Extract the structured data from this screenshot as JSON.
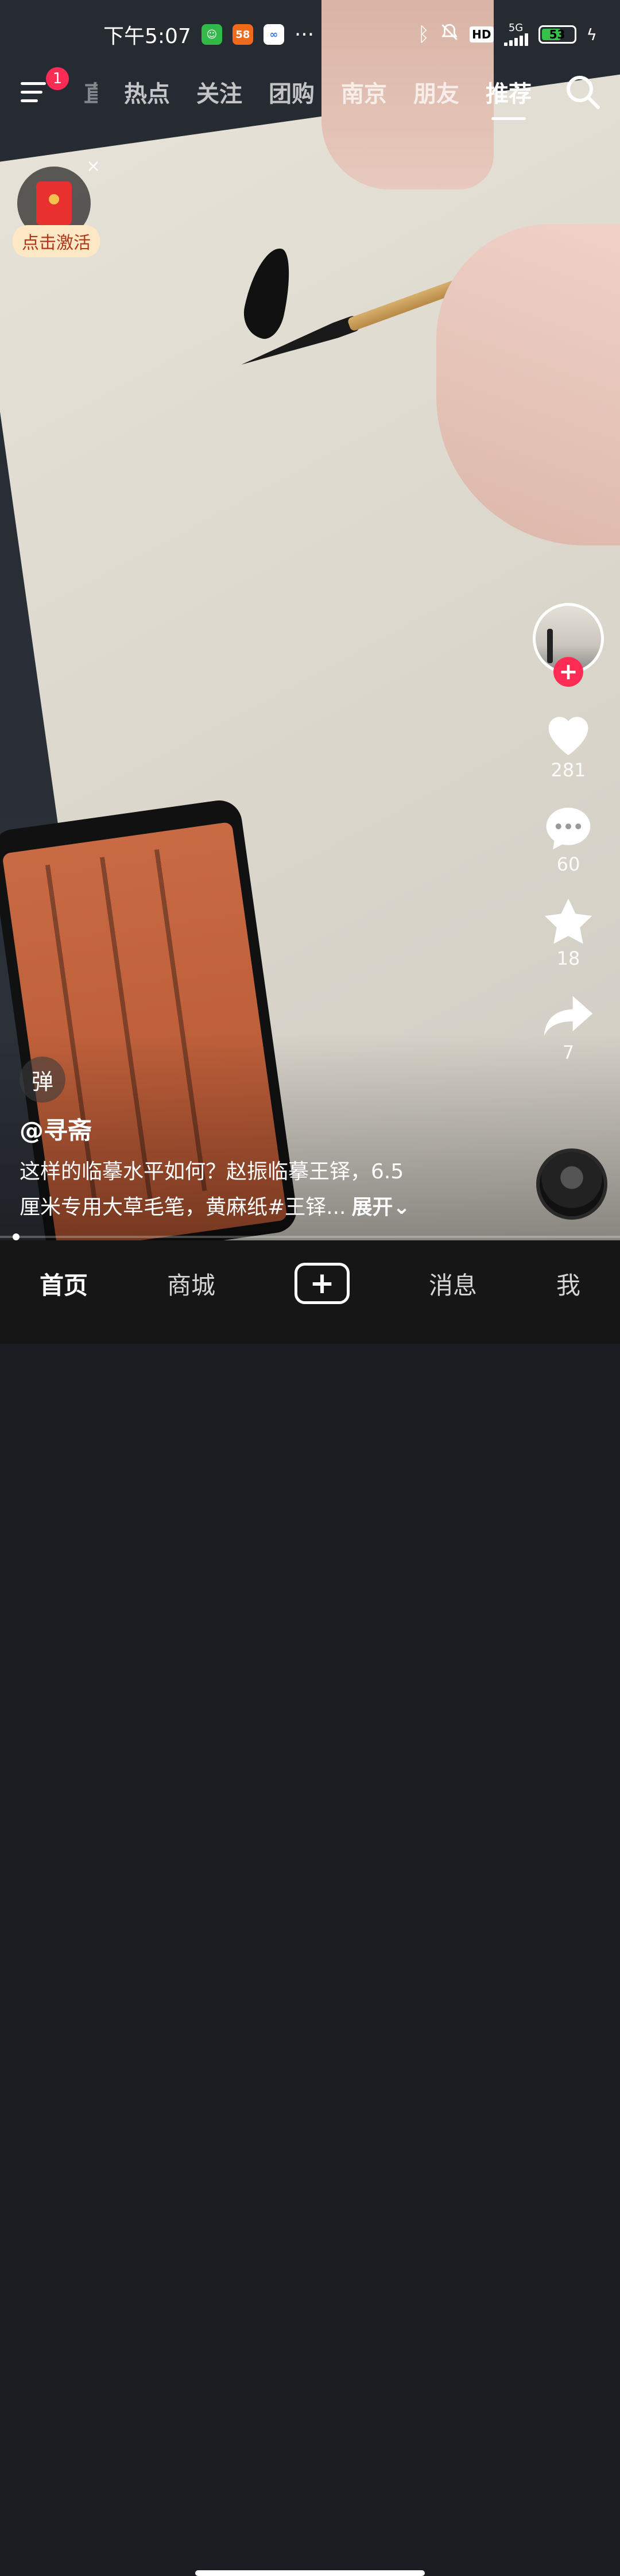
{
  "status_bar": {
    "time": "下午5:07",
    "app_58_label": "58",
    "more": "···",
    "hd_label": "HD",
    "network": "5G",
    "battery": "53"
  },
  "top_nav": {
    "menu_badge": "1",
    "partial_tab": "直播",
    "tabs": [
      {
        "label": "热点"
      },
      {
        "label": "关注"
      },
      {
        "label": "团购"
      },
      {
        "label": "南京"
      },
      {
        "label": "朋友"
      },
      {
        "label": "推荐"
      }
    ],
    "active_tab": "推荐"
  },
  "red_packet": {
    "label": "点击激活",
    "close": "×"
  },
  "right_rail": {
    "follow": "+",
    "likes": "281",
    "comments": "60",
    "favorites": "18",
    "shares": "7"
  },
  "video": {
    "danmaku_label": "弹",
    "author": "@寻斋",
    "caption_line1": "这样的临摹水平如何？赵振临摹王铎，6.5",
    "caption_line2": "厘米专用大草毛笔，黄麻纸#王铎...",
    "more_label": "展开",
    "progress": 0.02
  },
  "bottom_nav": {
    "items": [
      "首页",
      "商城",
      "消息",
      "我"
    ],
    "create": "+"
  },
  "colors": {
    "accent": "#fe2c55",
    "bottom_bar": "#161616"
  }
}
